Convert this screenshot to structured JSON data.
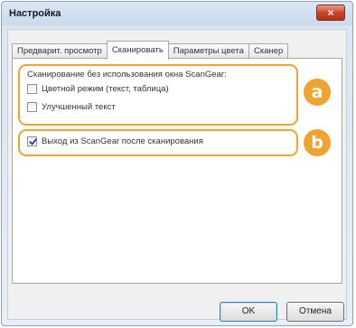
{
  "window": {
    "title": "Настройка",
    "close_glyph": "×"
  },
  "tabs": [
    {
      "label": "Предварит. просмотр",
      "active": false
    },
    {
      "label": "Сканировать",
      "active": true
    },
    {
      "label": "Параметры цвета",
      "active": false
    },
    {
      "label": "Сканер",
      "active": false
    }
  ],
  "group": {
    "label": "Сканирование без использования окна ScanGear:",
    "options": [
      {
        "label": "Цветной режим (текст, таблица)",
        "checked": false
      },
      {
        "label": "Улучшенный текст",
        "checked": false
      }
    ]
  },
  "exit_option": {
    "label": "Выход из ScanGear после сканирования",
    "checked": true
  },
  "callouts": {
    "a": "a",
    "b": "b",
    "color": "#f0a32e"
  },
  "buttons": {
    "ok": "OK",
    "cancel": "Отмена"
  }
}
